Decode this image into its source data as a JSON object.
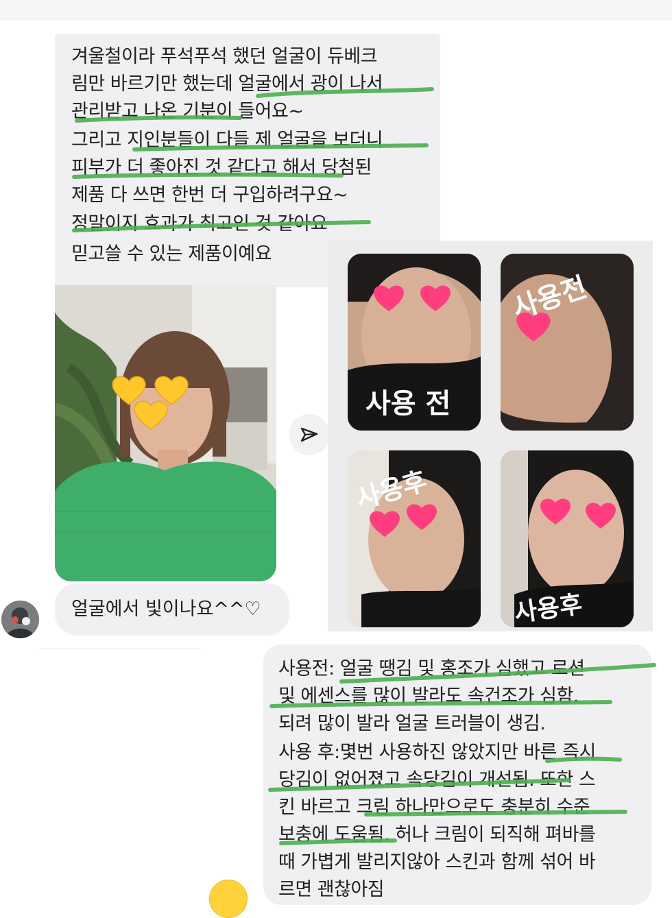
{
  "message_top": {
    "lines": [
      "겨울철이라 푸석푸석 했던 얼굴이 듀베크",
      "림만 바르기만 했는데 얼굴에서 광이 나서",
      "관리받고 나온 기분이 들어요~",
      "그리고 지인분들이 다들 제 얼굴을 보더니",
      "피부가 더 좋아진 것 같다고 해서 당첨된",
      "제품 다 쓰면 한번 더 구입하려구요~",
      "정말이지 효과가 최고인 것 같아요",
      "믿고쓸 수 있는 제품이예요"
    ]
  },
  "reply_short": "얼굴에서 빛이나요^^♡",
  "photo_grid": {
    "labels": [
      "사용 전",
      "사용전",
      "사용후",
      "사용후"
    ]
  },
  "message_bottom": {
    "lines": [
      "사용전: 얼굴 땡김 및 홍조가 심했고 로션",
      "및 에센스를 많이 발라도 속건조가 심함.",
      "되려 많이 발라 얼굴 트러블이 생김.",
      "사용 후:몇번 사용하진 않았지만 바른 즉시",
      "당김이 없어졌고 속당김이 개선됨. 또한 스",
      "킨 바르고 크림 하나만으로도 충분히 수준",
      "보충에 도움됨. 허나 크림이 되직해 펴바를",
      "때 가볍게 발리지않아 스킨과 함께 섞어 바",
      "르면 괜찮아짐"
    ]
  },
  "colors": {
    "bubble": "#f0f0f2",
    "highlight": "#4caf50",
    "heart_pink": "#ff3d7f",
    "heart_yellow": "#ffc72c",
    "sweater_green": "#3fae6a"
  },
  "icons": [
    "send-icon",
    "heart-icon",
    "avatar-image"
  ]
}
